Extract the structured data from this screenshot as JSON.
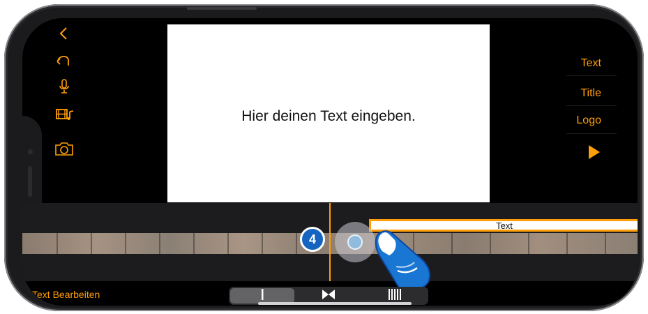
{
  "toolbar_left": {
    "icons": [
      "chevron-left-icon",
      "undo-icon",
      "microphone-icon",
      "film-music-icon",
      "camera-icon"
    ]
  },
  "preview": {
    "text": "Hier deinen Text eingeben."
  },
  "menu_right": {
    "items": [
      "Text",
      "Title",
      "Logo"
    ],
    "play_icon": "play-icon"
  },
  "timeline": {
    "title_clip_label": "Text",
    "step_number": "4"
  },
  "bottom": {
    "label": "Text Bearbeiten",
    "segments": [
      "title-start-icon",
      "title-middle-icon",
      "title-end-icon"
    ],
    "selected_segment": 0
  },
  "colors": {
    "accent": "#ff9f0a",
    "badge": "#1565c0"
  }
}
